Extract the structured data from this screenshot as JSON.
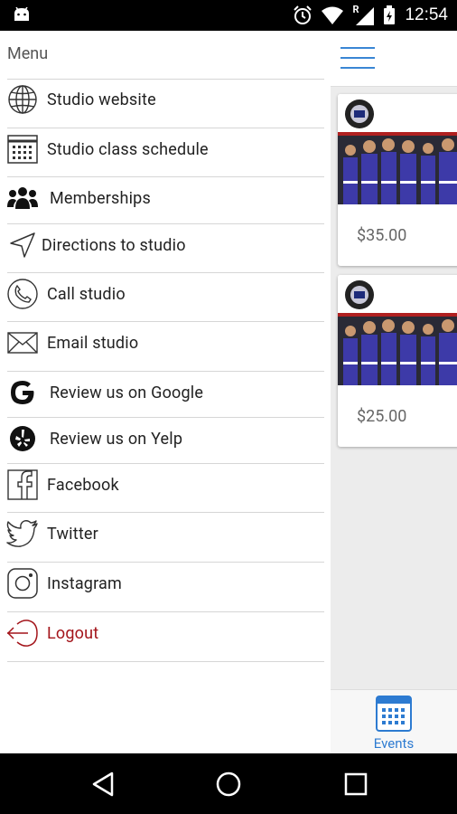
{
  "status_bar": {
    "time": "12:54",
    "network_badge": "R"
  },
  "drawer": {
    "title": "Menu",
    "items": [
      {
        "label": "Studio website",
        "icon": "globe-icon"
      },
      {
        "label": "Studio class schedule",
        "icon": "calendar-icon"
      },
      {
        "label": "Memberships",
        "icon": "users-icon"
      },
      {
        "label": "Directions to studio",
        "icon": "location-arrow-icon"
      },
      {
        "label": "Call studio",
        "icon": "phone-icon"
      },
      {
        "label": "Email studio",
        "icon": "envelope-icon"
      },
      {
        "label": "Review us on Google",
        "icon": "google-icon"
      },
      {
        "label": "Review us on Yelp",
        "icon": "yelp-icon"
      },
      {
        "label": "Facebook",
        "icon": "facebook-icon"
      },
      {
        "label": "Twitter",
        "icon": "twitter-icon"
      },
      {
        "label": "Instagram",
        "icon": "instagram-icon"
      },
      {
        "label": "Logout",
        "icon": "logout-icon"
      }
    ],
    "logout_color": "#a3141a"
  },
  "main": {
    "events": [
      {
        "price": "$35.00"
      },
      {
        "price": "$25.00"
      }
    ],
    "bottom_tab": {
      "label": "Events",
      "icon": "calendar-icon"
    },
    "accent_color": "#3a86d4"
  }
}
